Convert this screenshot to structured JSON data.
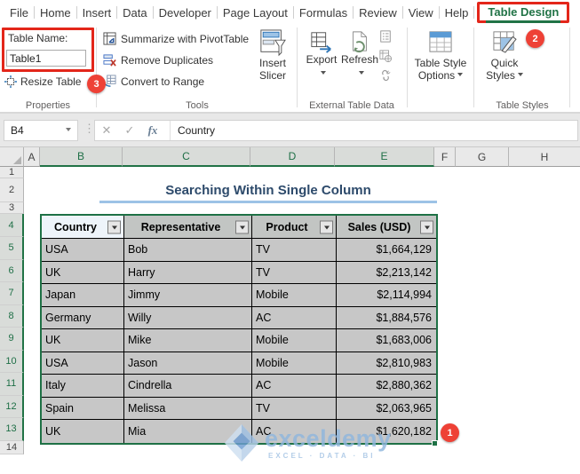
{
  "menu": {
    "tabs": [
      "File",
      "Home",
      "Insert",
      "Data",
      "Developer",
      "Page Layout",
      "Formulas",
      "Review",
      "View",
      "Help"
    ],
    "active_tab": "Table Design"
  },
  "ribbon": {
    "properties": {
      "group_label": "Properties",
      "table_name_label": "Table Name:",
      "table_name_value": "Table1",
      "resize_table_label": "Resize Table"
    },
    "tools": {
      "group_label": "Tools",
      "summarize_label": "Summarize with PivotTable",
      "remove_duplicates_label": "Remove Duplicates",
      "convert_to_range_label": "Convert to Range",
      "insert_slicer_line1": "Insert",
      "insert_slicer_line2": "Slicer"
    },
    "external": {
      "group_label": "External Table Data",
      "export_label": "Export",
      "refresh_label": "Refresh"
    },
    "style_options": {
      "line1": "Table Style",
      "line2": "Options"
    },
    "table_styles": {
      "group_label": "Table Styles",
      "quick_line1": "Quick",
      "quick_line2": "Styles"
    }
  },
  "annotations": {
    "badge1": "1",
    "badge2": "2",
    "badge3": "3"
  },
  "formula_bar": {
    "name_box": "B4",
    "formula_value": "Country",
    "icons": {
      "cancel": "✕",
      "enter": "✓",
      "fx": "fx",
      "grip": "⋮"
    }
  },
  "grid": {
    "columns": [
      "A",
      "B",
      "C",
      "D",
      "E",
      "F",
      "G",
      "H"
    ],
    "rows": [
      "1",
      "2",
      "3",
      "4",
      "5",
      "6",
      "7",
      "8",
      "9",
      "10",
      "11",
      "12",
      "13",
      "14"
    ],
    "selected_columns": "B:E",
    "selected_rows": "4:13",
    "title": "Searching Within Single Column"
  },
  "table": {
    "headers": [
      "Country",
      "Representative",
      "Product",
      "Sales (USD)"
    ],
    "rows": [
      [
        "USA",
        "Bob",
        "TV",
        "$1,664,129"
      ],
      [
        "UK",
        "Harry",
        "TV",
        "$2,213,142"
      ],
      [
        "Japan",
        "Jimmy",
        "Mobile",
        "$2,114,994"
      ],
      [
        "Germany",
        "Willy",
        "AC",
        "$1,884,576"
      ],
      [
        "UK",
        "Mike",
        "Mobile",
        "$1,683,006"
      ],
      [
        "USA",
        "Jason",
        "Mobile",
        "$2,810,983"
      ],
      [
        "Italy",
        "Cindrella",
        "AC",
        "$2,880,362"
      ],
      [
        "Spain",
        "Melissa",
        "TV",
        "$2,063,965"
      ],
      [
        "UK",
        "Mia",
        "AC",
        "$1,620,182"
      ]
    ]
  },
  "watermark": {
    "brand": "exceldemy",
    "tagline": "EXCEL · DATA · BI"
  },
  "colors": {
    "excel_green": "#217346",
    "annotation_red": "#ee4136",
    "title_blue": "#2d4a6b",
    "underline_blue": "#9dc3e6",
    "selection_fill": "#c7c7c7",
    "watermark_blue": "#8fb6de"
  }
}
